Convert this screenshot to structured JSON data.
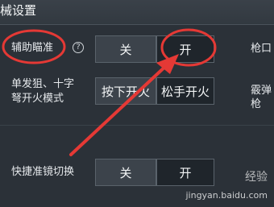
{
  "header": {
    "title": "械设置"
  },
  "settings": {
    "aim_assist": {
      "label": "辅助瞄准",
      "off": "关",
      "on": "开"
    },
    "fire_mode": {
      "label_line1": "单发狙、十字",
      "label_line2": "弩开火模式",
      "opt1": "按下开火",
      "opt2": "松手开火"
    },
    "scope_switch": {
      "label": "快捷准镜切换",
      "off": "关",
      "on": "开"
    }
  },
  "right_column": {
    "muzzle_partial": "枪口",
    "shotgun_partial": "霰弹枪"
  },
  "watermark": {
    "brand": "经验",
    "url": "jingyan.baidu.com"
  },
  "colors": {
    "annotation": "#e53935",
    "background": "#2b3138"
  }
}
